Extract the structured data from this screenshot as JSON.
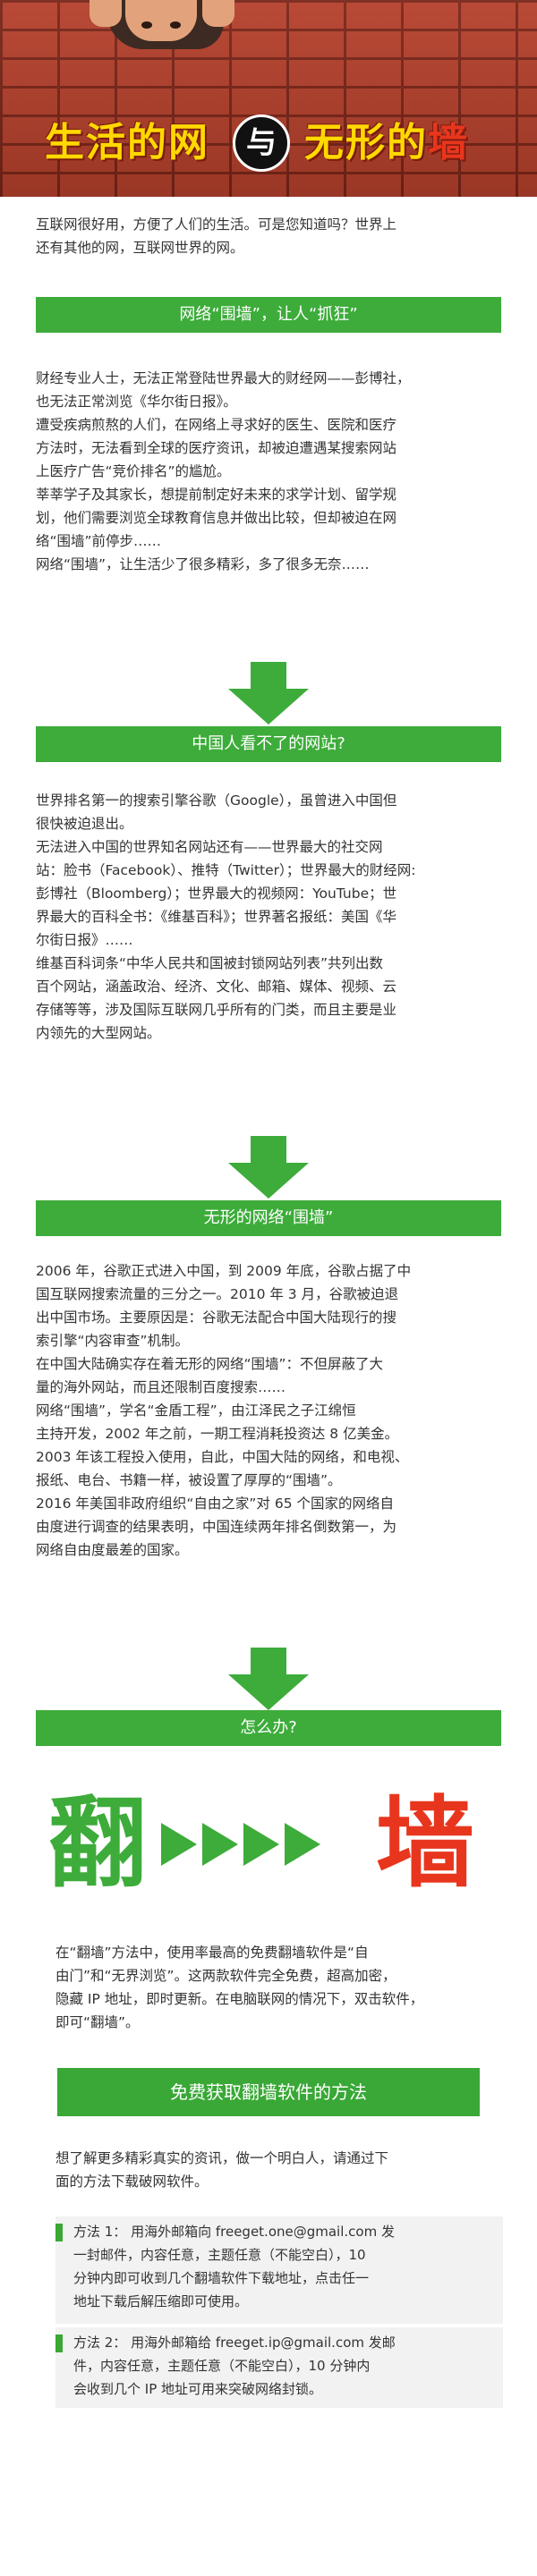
{
  "header": {
    "title_left": "生活的网",
    "title_mid": "与",
    "title_right_main": "无形的",
    "title_right_accent": "墙",
    "accent_color": "#e8361e",
    "title_color": "#ffd800"
  },
  "intro": [
    "互联网很好用，方便了人们的生活。可是您知道吗？世界上",
    "还有其他的网，互联网世界的网。"
  ],
  "section1": {
    "title": "网络“围墙”，让人“抓狂”",
    "lines": [
      "财经专业人士，无法正常登陆世界最大的财经网——彭博社，",
      "也无法正常浏览《华尔街日报》。",
      "遭受疾病煎熬的人们，在网络上寻求好的医生、医院和医疗",
      "方法时，无法看到全球的医疗资讯，却被迫遭遇某搜索网站",
      "上医疗广告“竞价排名”的尴尬。",
      "莘莘学子及其家长，想提前制定好未来的求学计划、留学规",
      "划，他们需要浏览全球教育信息并做出比较，但却被迫在网",
      "络“围墙”前停步……",
      "网络“围墙”，让生活少了很多精彩，多了很多无奈……"
    ]
  },
  "section2": {
    "title": "中国人看不了的网站?",
    "lines": [
      "世界排名第一的搜索引擎谷歌（Google），虽曾进入中国但",
      "很快被迫退出。",
      "无法进入中国的世界知名网站还有——世界最大的社交网",
      "站：脸书（Facebook）、推特（Twitter）；世界最大的财经网:",
      "彭博社（Bloomberg）；世界最大的视频网：YouTube；世",
      "界最大的百科全书：《维基百科》；世界著名报纸：美国《华",
      "尔街日报》……",
      "维基百科词条“中华人民共和国被封锁网站列表”共列出数",
      "百个网站，涵盖政治、经济、文化、邮箱、媒体、视频、云",
      "存储等等，涉及国际互联网几乎所有的门类，而且主要是业",
      "内领先的大型网站。"
    ]
  },
  "section3": {
    "title": "无形的网络“围墙”",
    "lines": [
      "2006 年，谷歌正式进入中国，到 2009 年底，谷歌占据了中",
      "国互联网搜索流量的三分之一。2010 年 3 月，谷歌被迫退",
      "出中国市场。主要原因是：谷歌无法配合中国大陆现行的搜",
      "索引擎“内容审查”机制。",
      "在中国大陆确实存在着无形的网络“围墙”：不但屏蔽了大",
      "量的海外网站，而且还限制百度搜索……",
      "网络“围墙”，学名“金盾工程”，由江泽民之子江绵恒",
      "主持开发，2002 年之前，一期工程消耗投资达 8 亿美金。",
      "2003 年该工程投入使用，自此，中国大陆的网络，和电视、",
      "报纸、电台、书籍一样，被设置了厚厚的“围墙”。",
      "2016 年美国非政府组织“自由之家”对 65 个国家的网络自",
      "由度进行调查的结果表明，中国连续两年排名倒数第一，为",
      "网络自由度最差的国家。"
    ]
  },
  "section4": {
    "title": "怎么办?",
    "fan": "翻",
    "qiang": "墙",
    "fan_color": "#3dac3a",
    "qiang_color": "#e8361e",
    "lines": [
      "在“翻墙”方法中，使用率最高的免费翻墙软件是“自",
      "由门”和“无界浏览”。这两款软件完全免费，超高加密，",
      "隐藏 IP 地址，即时更新。在电脑联网的情况下，双击软件，",
      "即可“翻墙”。"
    ]
  },
  "download": {
    "button": "免费获取翻墙软件的方法",
    "intro": [
      "想了解更多精彩真实的资讯，做一个明白人，请通过下",
      "面的方法下载破网软件。"
    ],
    "method1": [
      "方法 1：  用海外邮箱向 freeget.one@gmail.com 发",
      "一封邮件，内容任意，主题任意（不能空白），10",
      "分钟内即可收到几个翻墙软件下载地址，点击任一",
      "地址下载后解压缩即可使用。"
    ],
    "method2": [
      "方法 2：  用海外邮箱给 freeget.ip@gmail.com 发邮",
      "件，内容任意，主题任意（不能空白），10 分钟内",
      "会收到几个 IP 地址可用来突破网络封锁。"
    ]
  }
}
